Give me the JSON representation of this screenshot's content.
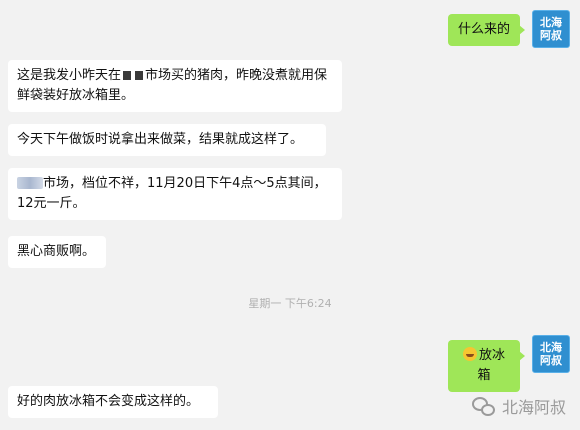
{
  "avatar": {
    "line1": "北海",
    "line2": "阿叔",
    "color": "#2f8fd0"
  },
  "messages": {
    "m1": "什么来的",
    "m2_a": "这是我发小昨天在",
    "m2_b": "市场买的猪肉，昨晚没煮就用保鲜袋装好放冰箱里。",
    "m3": "今天下午做饭时说拿出来做菜，结果就成这样了。",
    "m4_a": "市场，档位不祥，11月20日下午4点～5点其间，12元一斤。",
    "m5": "黑心商贩啊。",
    "m6": "放冰箱",
    "m7": "好的肉放冰箱不会变成这样的。"
  },
  "timestamp": "星期一 下午6:24",
  "watermark": {
    "text": "北海阿叔",
    "icon": "wechat-icon"
  },
  "colors": {
    "outgoing": "#9fe658",
    "incoming": "#ffffff",
    "background": "#f2f2f2"
  }
}
